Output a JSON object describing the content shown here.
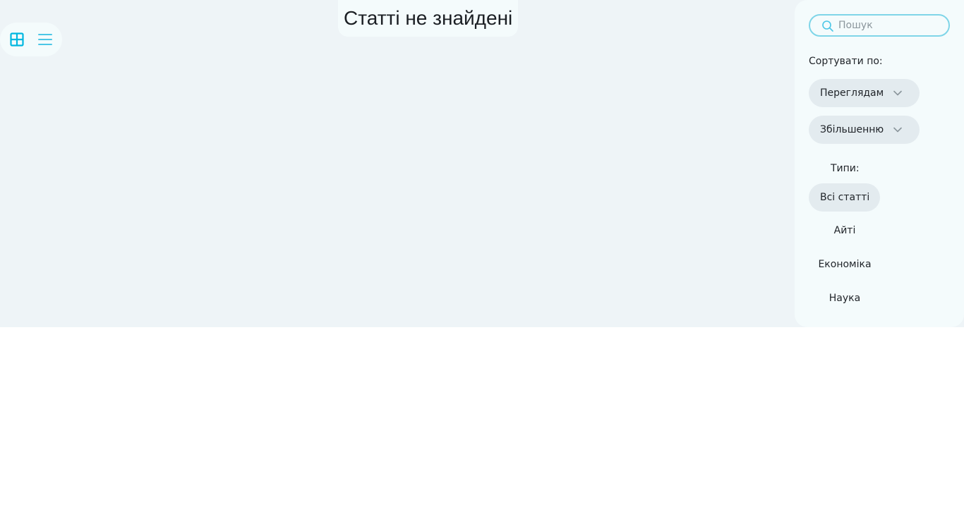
{
  "view_toggle": {
    "grid_icon": "grid-view-icon",
    "list_icon": "list-view-icon",
    "active_view": "grid"
  },
  "main": {
    "empty_message": "Статті не знайдені"
  },
  "sidebar": {
    "search": {
      "placeholder": "Пошук",
      "value": "",
      "icon": "search-icon"
    },
    "sort_label": "Сортувати по:",
    "sort_by": {
      "selected": "Переглядам",
      "icon": "chevron-down-icon"
    },
    "sort_order": {
      "selected": "Збільшенню",
      "icon": "chevron-down-icon"
    },
    "types_label": "Типи:",
    "types": [
      {
        "label": "Всі статті",
        "active": true
      },
      {
        "label": "Айті",
        "active": false
      },
      {
        "label": "Економіка",
        "active": false
      },
      {
        "label": "Наука",
        "active": false
      }
    ]
  },
  "colors": {
    "accent": "#00b7e0",
    "accent_light": "#4cc6e6",
    "page_bg": "#eef4f7",
    "panel_bg": "#f4fbfc",
    "pill_bg": "#e3ebef",
    "search_border": "#7fd5e8"
  }
}
